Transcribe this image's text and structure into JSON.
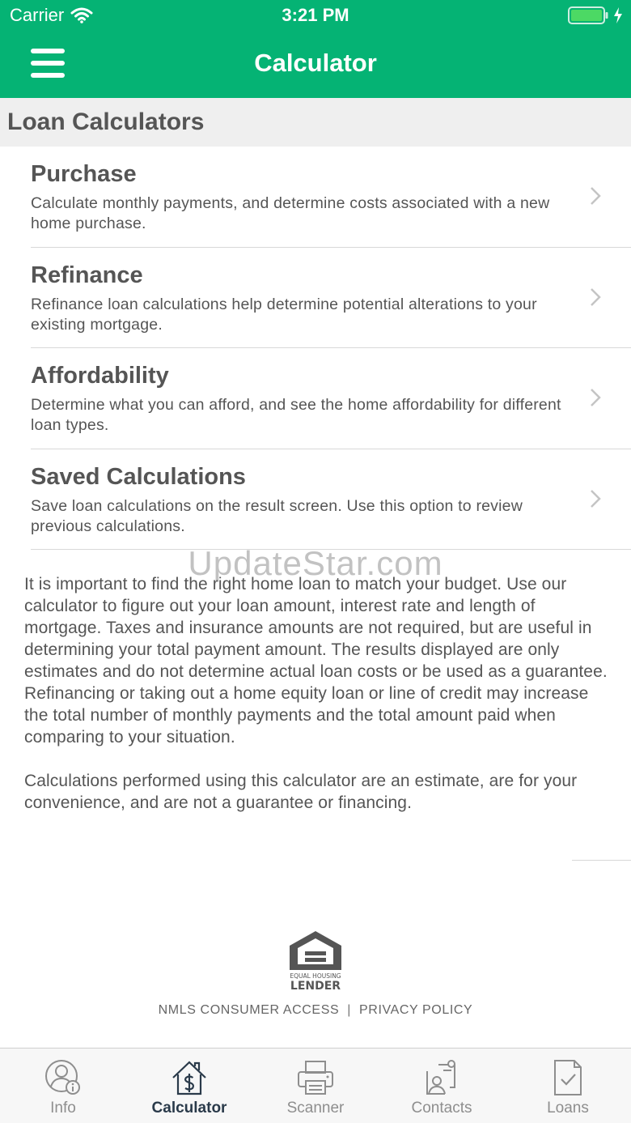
{
  "status_bar": {
    "carrier": "Carrier",
    "time": "3:21 PM"
  },
  "nav": {
    "title": "Calculator"
  },
  "section": {
    "title": "Loan Calculators"
  },
  "items": [
    {
      "title": "Purchase",
      "description": "Calculate monthly payments, and determine costs associated with a new home purchase."
    },
    {
      "title": "Refinance",
      "description": "Refinance loan calculations help determine potential alterations to your existing mortgage."
    },
    {
      "title": "Affordability",
      "description": "Determine what you can afford, and see the home affordability for different loan types."
    },
    {
      "title": "Saved Calculations",
      "description": "Save loan calculations on the result screen. Use this option to review previous calculations."
    }
  ],
  "watermark": "UpdateStar.com",
  "info": {
    "paragraph1": "It is important to find the right home loan to match your budget. Use our calculator to figure out your loan amount, interest rate and length of mortgage.  Taxes and insurance amounts are not required, but are useful in determining your total payment amount.  The results displayed are only estimates and do not determine actual loan costs or be used as a guarantee.  Refinancing or taking out a home equity loan  or line of credit may increase the total number of monthly payments and the total amount paid when comparing to your situation.",
    "paragraph2": "Calculations performed using this calculator are an estimate, are for your convenience, and are not a guarantee or financing."
  },
  "logo": {
    "line1": "EQUAL HOUSING",
    "line2": "LENDER"
  },
  "footer": {
    "nmls": "NMLS CONSUMER ACCESS",
    "separator": "|",
    "privacy": "PRIVACY POLICY"
  },
  "tabs": [
    {
      "label": "Info",
      "icon": "person-info-icon",
      "active": false
    },
    {
      "label": "Calculator",
      "icon": "house-dollar-icon",
      "active": true
    },
    {
      "label": "Scanner",
      "icon": "scanner-icon",
      "active": false
    },
    {
      "label": "Contacts",
      "icon": "contacts-icon",
      "active": false
    },
    {
      "label": "Loans",
      "icon": "document-check-icon",
      "active": false
    }
  ],
  "colors": {
    "brand": "#05b374",
    "tab_active": "#2a3a4a",
    "tab_inactive": "#8e8e8e"
  }
}
